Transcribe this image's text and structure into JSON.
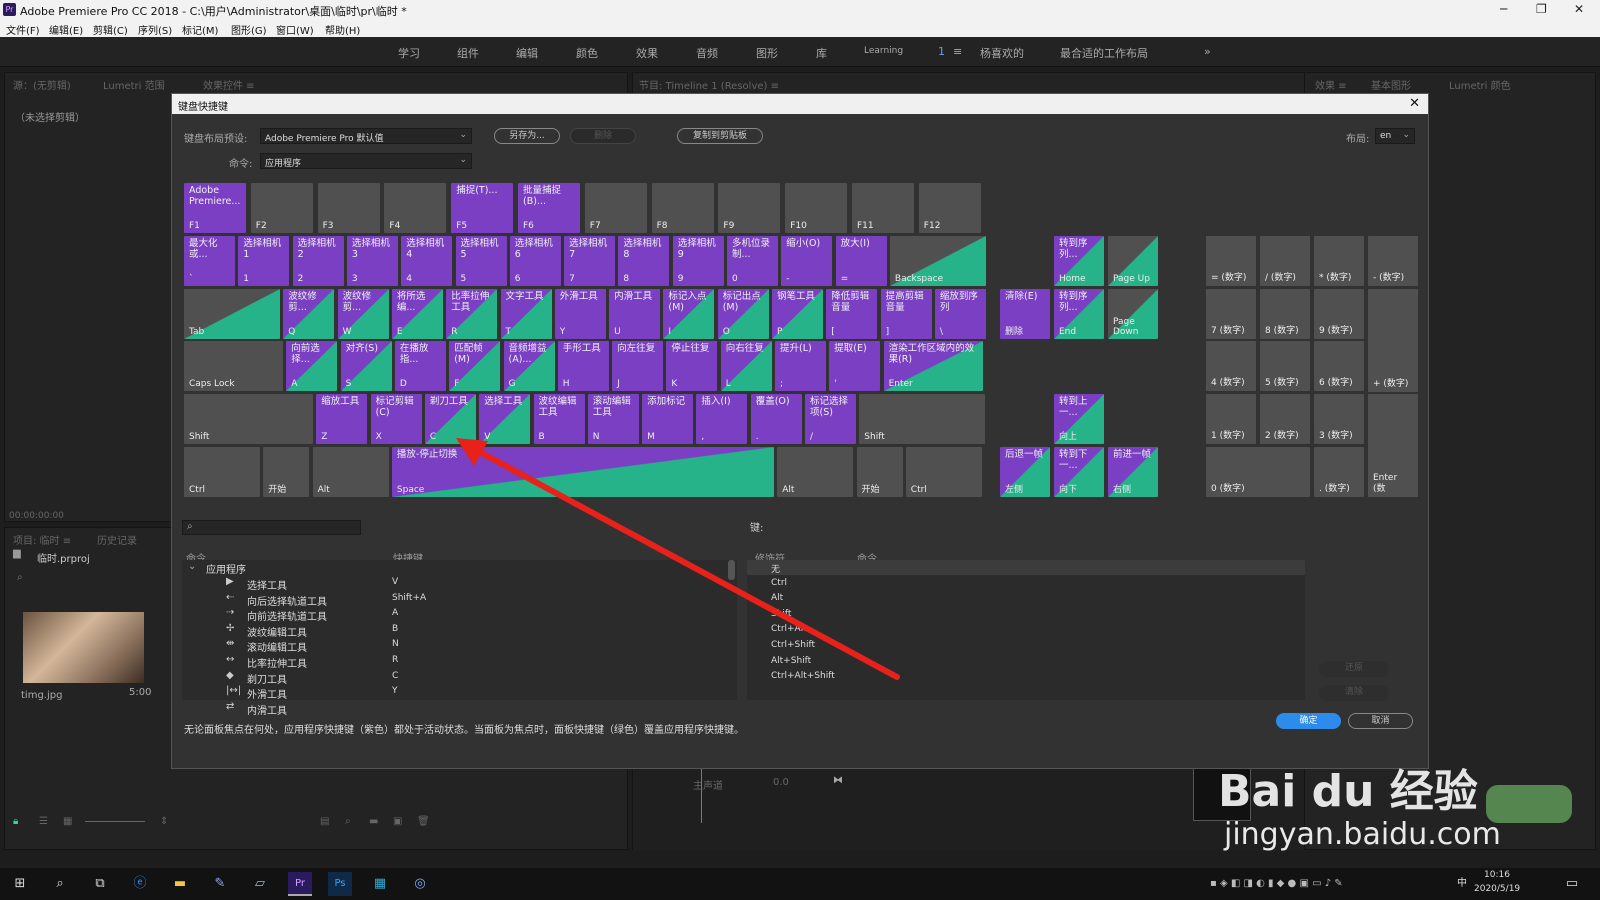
{
  "window": {
    "title": "Adobe Premiere Pro CC 2018 - C:\\用户\\Administrator\\桌面\\临时\\pr\\临时 *",
    "app_icon": "Pr"
  },
  "menubar": [
    "文件(F)",
    "编辑(E)",
    "剪辑(C)",
    "序列(S)",
    "标记(M)",
    "图形(G)",
    "窗口(W)",
    "帮助(H)"
  ],
  "workspaces": [
    "学习",
    "组件",
    "编辑",
    "颜色",
    "效果",
    "音频",
    "图形",
    "库",
    "Learning",
    "1",
    "≡",
    "杨喜欢的",
    "最合适的工作布局",
    "»"
  ],
  "panels": {
    "source_tab": "源：(无剪辑)",
    "lumetri_scope": "Lumetri 范围",
    "effect_controls": "效果控件 ≡",
    "no_clip": "（未选择剪辑）",
    "program_tab": "节目: Timeline 1 (Resolve) ≡",
    "effects_tab": "效果 ≡",
    "essential_graphics": "基本图形",
    "lumetri_color": "Lumetri 颜色",
    "timecode": "00:00:00:00",
    "project_tab": "项目: 临时 ≡",
    "history_tab": "历史记录",
    "project_file": "临时.prproj",
    "clip_name": "timg.jpg",
    "clip_duration": "5:00",
    "audio_track": "主声道",
    "audio_value": "0.0"
  },
  "dialog": {
    "title": "键盘快捷键",
    "preset_label": "键盘布局预设:",
    "preset_value": "Adobe Premiere Pro 默认值",
    "save_as": "另存为...",
    "delete": "删除",
    "copy_clipboard": "复制到剪贴板",
    "layout_label": "布局:",
    "layout_value": "en",
    "command_label": "命令:",
    "command_value": "应用程序",
    "keys_label": "键:",
    "col_command": "命令",
    "col_shortcut": "快捷键",
    "col_modifier": "修饰符",
    "col_command2": "命令",
    "tree_root": "应用程序",
    "commands": [
      {
        "icon": "▶",
        "name": "选择工具",
        "shortcut": "V"
      },
      {
        "icon": "⇠",
        "name": "向后选择轨道工具",
        "shortcut": "Shift+A"
      },
      {
        "icon": "⇢",
        "name": "向前选择轨道工具",
        "shortcut": "A"
      },
      {
        "icon": "✢",
        "name": "波纹编辑工具",
        "shortcut": "B"
      },
      {
        "icon": "⇹",
        "name": "滚动编辑工具",
        "shortcut": "N"
      },
      {
        "icon": "↔",
        "name": "比率拉伸工具",
        "shortcut": "R"
      },
      {
        "icon": "◆",
        "name": "剃刀工具",
        "shortcut": "C"
      },
      {
        "icon": "|↔|",
        "name": "外滑工具",
        "shortcut": "Y"
      },
      {
        "icon": "⇄",
        "name": "内滑工具",
        "shortcut": ""
      }
    ],
    "modifiers": [
      "无",
      "Ctrl",
      "Alt",
      "Shift",
      "Ctrl+Alt",
      "Ctrl+Shift",
      "Alt+Shift",
      "Ctrl+Alt+Shift"
    ],
    "restore": "还原",
    "clear": "清除",
    "footer": "无论面板焦点在何处，应用程序快捷键（紫色）都处于活动状态。当面板为焦点时，面板快捷键（绿色）覆盖应用程序快捷键。",
    "ok": "确定",
    "cancel": "取消"
  },
  "keyboard": {
    "rows": [
      [
        {
          "cap": "F1",
          "cmd": "Adobe Premiere...",
          "type": "app"
        },
        {
          "cap": "F2",
          "cmd": "",
          "type": "none"
        },
        {
          "cap": "F3",
          "cmd": "",
          "type": "none"
        },
        {
          "cap": "F4",
          "cmd": "",
          "type": "none"
        },
        {
          "cap": "F5",
          "cmd": "捕捉(T)...",
          "type": "app"
        },
        {
          "cap": "F6",
          "cmd": "批量捕捉(B)...",
          "type": "app"
        },
        {
          "cap": "F7",
          "cmd": "",
          "type": "none"
        },
        {
          "cap": "F8",
          "cmd": "",
          "type": "none"
        },
        {
          "cap": "F9",
          "cmd": "",
          "type": "none"
        },
        {
          "cap": "F10",
          "cmd": "",
          "type": "none"
        },
        {
          "cap": "F11",
          "cmd": "",
          "type": "none"
        },
        {
          "cap": "F12",
          "cmd": "",
          "type": "none"
        }
      ],
      [
        {
          "cap": "`",
          "cmd": "最大化或...",
          "type": "app"
        },
        {
          "cap": "1",
          "cmd": "选择相机 1",
          "type": "app"
        },
        {
          "cap": "2",
          "cmd": "选择相机 2",
          "type": "app"
        },
        {
          "cap": "3",
          "cmd": "选择相机 3",
          "type": "app"
        },
        {
          "cap": "4",
          "cmd": "选择相机 4",
          "type": "app"
        },
        {
          "cap": "5",
          "cmd": "选择相机 5",
          "type": "app"
        },
        {
          "cap": "6",
          "cmd": "选择相机 6",
          "type": "app"
        },
        {
          "cap": "7",
          "cmd": "选择相机 7",
          "type": "app"
        },
        {
          "cap": "8",
          "cmd": "选择相机 8",
          "type": "app"
        },
        {
          "cap": "9",
          "cmd": "选择相机 9",
          "type": "app"
        },
        {
          "cap": "0",
          "cmd": "多机位录制...",
          "type": "app"
        },
        {
          "cap": "-",
          "cmd": "缩小(O)",
          "type": "app"
        },
        {
          "cap": "=",
          "cmd": "放大(I)",
          "type": "app"
        },
        {
          "cap": "Backspace",
          "cmd": "",
          "type": "pan"
        }
      ],
      [
        {
          "cap": "Tab",
          "cmd": "",
          "type": "pan"
        },
        {
          "cap": "Q",
          "cmd": "波纹修剪...",
          "type": "both"
        },
        {
          "cap": "W",
          "cmd": "波纹修剪...",
          "type": "both"
        },
        {
          "cap": "E",
          "cmd": "将所选编...",
          "type": "both"
        },
        {
          "cap": "R",
          "cmd": "比率拉伸工具",
          "type": "both"
        },
        {
          "cap": "T",
          "cmd": "文字工具",
          "type": "both"
        },
        {
          "cap": "Y",
          "cmd": "外滑工具",
          "type": "app"
        },
        {
          "cap": "U",
          "cmd": "内滑工具",
          "type": "app"
        },
        {
          "cap": "I",
          "cmd": "标记入点(M)",
          "type": "both"
        },
        {
          "cap": "O",
          "cmd": "标记出点(M)",
          "type": "both"
        },
        {
          "cap": "P",
          "cmd": "钢笔工具",
          "type": "both"
        },
        {
          "cap": "[",
          "cmd": "降低剪辑音量",
          "type": "app"
        },
        {
          "cap": "]",
          "cmd": "提高剪辑音量",
          "type": "app"
        },
        {
          "cap": "\\",
          "cmd": "缩放到序列",
          "type": "app"
        }
      ],
      [
        {
          "cap": "Caps Lock",
          "cmd": "",
          "type": "none"
        },
        {
          "cap": "A",
          "cmd": "向前选择...",
          "type": "both"
        },
        {
          "cap": "S",
          "cmd": "对齐(S)",
          "type": "both"
        },
        {
          "cap": "D",
          "cmd": "在播放指...",
          "type": "app"
        },
        {
          "cap": "F",
          "cmd": "匹配帧(M)",
          "type": "both"
        },
        {
          "cap": "G",
          "cmd": "音频增益(A)...",
          "type": "both"
        },
        {
          "cap": "H",
          "cmd": "手形工具",
          "type": "app"
        },
        {
          "cap": "J",
          "cmd": "向左往复",
          "type": "app"
        },
        {
          "cap": "K",
          "cmd": "停止往复",
          "type": "app"
        },
        {
          "cap": "L",
          "cmd": "向右往复",
          "type": "both"
        },
        {
          "cap": ";",
          "cmd": "提升(L)",
          "type": "app"
        },
        {
          "cap": "'",
          "cmd": "提取(E)",
          "type": "app"
        },
        {
          "cap": "Enter",
          "cmd": "渲染工作区域内的效果(R)",
          "type": "both"
        }
      ],
      [
        {
          "cap": "Shift",
          "cmd": "",
          "type": "none"
        },
        {
          "cap": "Z",
          "cmd": "缩放工具",
          "type": "app"
        },
        {
          "cap": "X",
          "cmd": "标记剪辑(C)",
          "type": "app"
        },
        {
          "cap": "C",
          "cmd": "剃刀工具",
          "type": "both"
        },
        {
          "cap": "V",
          "cmd": "选择工具",
          "type": "both"
        },
        {
          "cap": "B",
          "cmd": "波纹编辑工具",
          "type": "app"
        },
        {
          "cap": "N",
          "cmd": "滚动编辑工具",
          "type": "app"
        },
        {
          "cap": "M",
          "cmd": "添加标记",
          "type": "app"
        },
        {
          "cap": ",",
          "cmd": "插入(I)",
          "type": "app"
        },
        {
          "cap": ".",
          "cmd": "覆盖(O)",
          "type": "app"
        },
        {
          "cap": "/",
          "cmd": "标记选择项(S)",
          "type": "app"
        },
        {
          "cap": "Shift",
          "cmd": "",
          "type": "none"
        }
      ],
      [
        {
          "cap": "Ctrl",
          "cmd": "",
          "type": "none"
        },
        {
          "cap": "开始",
          "cmd": "",
          "type": "none"
        },
        {
          "cap": "Alt",
          "cmd": "",
          "type": "none"
        },
        {
          "cap": "Space",
          "cmd": "播放-停止切换",
          "type": "both"
        },
        {
          "cap": "Alt",
          "cmd": "",
          "type": "none"
        },
        {
          "cap": "开始",
          "cmd": "",
          "type": "none"
        },
        {
          "cap": "Ctrl",
          "cmd": "",
          "type": "none"
        }
      ]
    ],
    "nav": [
      {
        "cap": "Home",
        "cmd": "转到序列...",
        "type": "both"
      },
      {
        "cap": "Page Up",
        "cmd": "",
        "type": "pan"
      },
      {
        "cap": "删除",
        "cmd": "清除(E)",
        "type": "app"
      },
      {
        "cap": "End",
        "cmd": "转到序列...",
        "type": "both"
      },
      {
        "cap": "Page Down",
        "cmd": "",
        "type": "pan"
      },
      {
        "cap": "向上",
        "cmd": "转到上一...",
        "type": "both"
      },
      {
        "cap": "左侧",
        "cmd": "后退一帧",
        "type": "both"
      },
      {
        "cap": "向下",
        "cmd": "转到下一...",
        "type": "both"
      },
      {
        "cap": "右侧",
        "cmd": "前进一帧",
        "type": "both"
      }
    ],
    "numpad": [
      {
        "cap": "= (数字)"
      },
      {
        "cap": "/ (数字)"
      },
      {
        "cap": "* (数字)"
      },
      {
        "cap": "- (数字)"
      },
      {
        "cap": "7 (数字)"
      },
      {
        "cap": "8 (数字)"
      },
      {
        "cap": "9 (数字)"
      },
      {
        "cap": "+ (数字)"
      },
      {
        "cap": "4 (数字)"
      },
      {
        "cap": "5 (数字)"
      },
      {
        "cap": "6 (数字)"
      },
      {
        "cap": "1 (数字)"
      },
      {
        "cap": "2 (数字)"
      },
      {
        "cap": "3 (数字)"
      },
      {
        "cap": "Enter (数"
      },
      {
        "cap": "0 (数字)"
      },
      {
        "cap": ". (数字)"
      }
    ]
  },
  "taskbar": {
    "time": "10:16",
    "date": "2020/5/19",
    "ime": "中"
  },
  "watermark": {
    "brand": "Bai du 经验",
    "url": "jingyan.baidu.com"
  },
  "colors": {
    "application_shortcut": "#7a3fc2",
    "panel_shortcut": "#26b38a",
    "ok_button": "#2d8ceb",
    "annotation_arrow": "#e8211b"
  }
}
